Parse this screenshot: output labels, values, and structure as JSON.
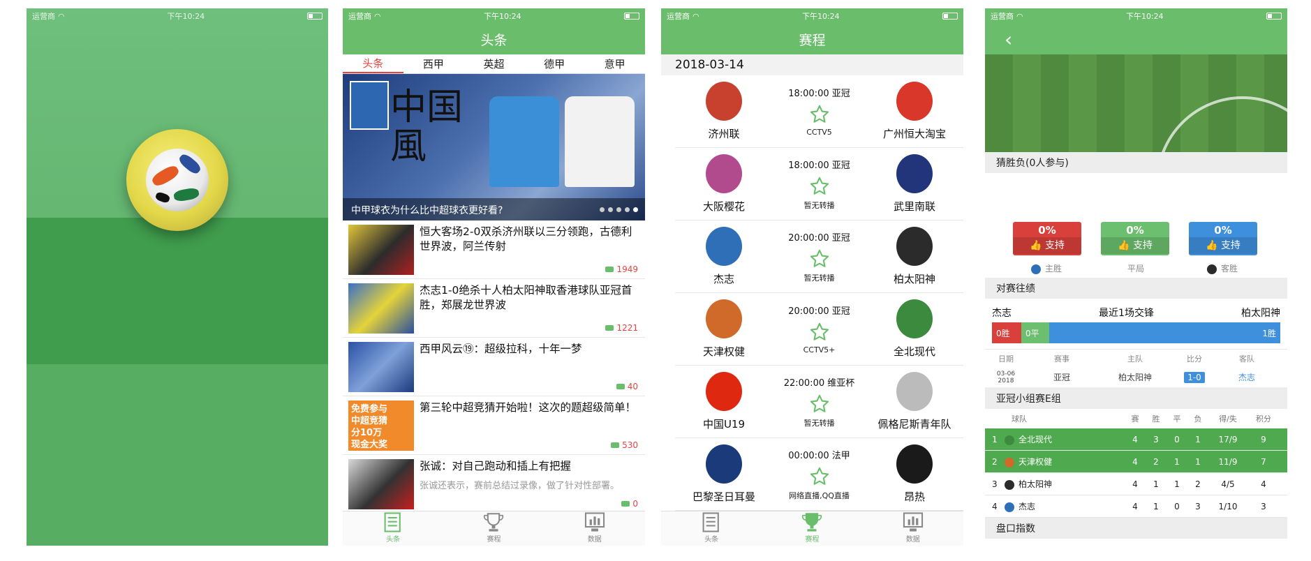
{
  "status": {
    "carrier": "运营商",
    "time": "下午10:24"
  },
  "news_screen": {
    "title": "头条",
    "tabs": [
      "头条",
      "西甲",
      "英超",
      "德甲",
      "意甲"
    ],
    "banner_caption": "中甲球衣为什么比中超球衣更好看?",
    "banner_text": "中国風",
    "items": [
      {
        "title": "恒大客场2-0双杀济州联以三分领跑，古德利世界波，阿兰传射",
        "count": "1949"
      },
      {
        "title": "杰志1-0绝杀十人柏太阳神取香港球队亚冠首胜，郑展龙世界波",
        "count": "1221"
      },
      {
        "title": "西甲风云⑲：超级拉科，十年一梦",
        "count": "40"
      },
      {
        "title": "第三轮中超竞猜开始啦！这次的题超级简单！",
        "count": "530"
      },
      {
        "title": "张诚：对自己跑动和插上有把握",
        "sub": "张诚还表示，赛前总结过录像，做了针对性部署。",
        "count": "0"
      }
    ],
    "promo": [
      "免费参与",
      "中超竞猜",
      "分10万",
      "现金大奖"
    ]
  },
  "tabbar": {
    "news": "头条",
    "schedule": "赛程",
    "data": "数据"
  },
  "schedule_screen": {
    "title": "赛程",
    "date": "2018-03-14",
    "matches": [
      {
        "home": "济州联",
        "away": "广州恒大淘宝",
        "time": "18:00:00",
        "comp": "亚冠",
        "tv": "CCTV5",
        "home_color": "#c8412f",
        "away_color": "#d8372a"
      },
      {
        "home": "大阪樱花",
        "away": "武里南联",
        "time": "18:00:00",
        "comp": "亚冠",
        "tv": "暂无转播",
        "home_color": "#b24a8e",
        "away_color": "#22357a"
      },
      {
        "home": "杰志",
        "away": "柏太阳神",
        "time": "20:00:00",
        "comp": "亚冠",
        "tv": "暂无转播",
        "home_color": "#2e6fb8",
        "away_color": "#2b2b2b"
      },
      {
        "home": "天津权健",
        "away": "全北现代",
        "time": "20:00:00",
        "comp": "亚冠",
        "tv": "CCTV5+",
        "home_color": "#cf6a2a",
        "away_color": "#3c8a3e"
      },
      {
        "home": "中国U19",
        "away": "佩格尼斯青年队",
        "time": "22:00:00",
        "comp": "维亚杯",
        "tv": "暂无转播",
        "home_color": "#de2910",
        "away_color": "#bbbbbb"
      },
      {
        "home": "巴黎圣日耳曼",
        "away": "昂热",
        "time": "00:00:00",
        "comp": "法甲",
        "tv": "网络直播,QQ直播",
        "home_color": "#1b3a7a",
        "away_color": "#1a1a1a"
      }
    ]
  },
  "detail_screen": {
    "guess_title": "猜胜负(0人参与)",
    "votes": [
      {
        "pct": "0%",
        "label": "支持",
        "caption": "主胜",
        "color": "#d9403b"
      },
      {
        "pct": "0%",
        "label": "支持",
        "caption": "平局",
        "color": "#6cbf6e"
      },
      {
        "pct": "0%",
        "label": "支持",
        "caption": "客胜",
        "color": "#3e8fdc"
      }
    ],
    "record_title": "对赛往绩",
    "home": "杰志",
    "away": "柏太阳神",
    "record_summary": "最近1场交锋",
    "bar": {
      "win": "0胜",
      "draw": "0平",
      "loss": "1胜"
    },
    "record_headers": [
      "日期",
      "赛事",
      "主队",
      "比分",
      "客队"
    ],
    "record_rows": [
      {
        "date": "03-06",
        "year": "2018",
        "comp": "亚冠",
        "home": "柏太阳神",
        "score": "1-0",
        "away": "杰志"
      }
    ],
    "group_title": "亚冠小组赛E组",
    "group_headers": [
      "球队",
      "赛",
      "胜",
      "平",
      "负",
      "得/失",
      "积分"
    ],
    "group_rows": [
      {
        "rank": "1",
        "team": "全北现代",
        "p": "4",
        "w": "3",
        "d": "0",
        "l": "1",
        "gf": "17/9",
        "pts": "9"
      },
      {
        "rank": "2",
        "team": "天津权健",
        "p": "4",
        "w": "2",
        "d": "1",
        "l": "1",
        "gf": "11/9",
        "pts": "7"
      },
      {
        "rank": "3",
        "team": "柏太阳神",
        "p": "4",
        "w": "1",
        "d": "1",
        "l": "2",
        "gf": "4/5",
        "pts": "4"
      },
      {
        "rank": "4",
        "team": "杰志",
        "p": "4",
        "w": "1",
        "d": "0",
        "l": "3",
        "gf": "1/10",
        "pts": "3"
      }
    ],
    "odds_title": "盘口指数"
  }
}
